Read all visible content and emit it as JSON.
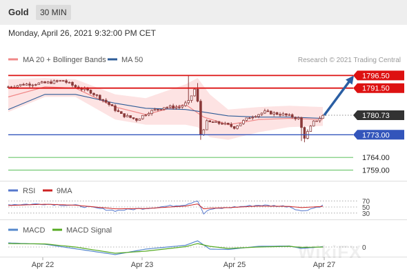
{
  "header": {
    "symbol": "Gold",
    "timeframe": "30 MIN",
    "datetime": "Monday, April 26, 2021 9:32:00 PM CET"
  },
  "colors": {
    "resistance": "#dd1111",
    "support": "#3355bb",
    "target_line": "#22aa22",
    "ma20": "#f08888",
    "bollinger_fill": "#fde3e3",
    "ma50": "#2d5b97",
    "candle": "#8a3a3a",
    "rsi": "#5577cc",
    "ma9": "#cc2222",
    "macd": "#5588cc",
    "macd_signal": "#55aa22",
    "arrow": "#2a5ea3"
  },
  "main_chart": {
    "legend": [
      {
        "label": "MA 20 + Bollinger Bands",
        "color": "#f08888"
      },
      {
        "label": "MA 50",
        "color": "#2d5b97"
      }
    ],
    "credit": "Research © 2021 Trading Central",
    "x_ticks": [
      "Apr 22",
      "Apr 23",
      "Apr 25",
      "Apr 27"
    ],
    "levels": [
      {
        "value": 1796.5,
        "label": "1796.50",
        "kind": "resistance"
      },
      {
        "value": 1791.5,
        "label": "1791.50",
        "kind": "resistance"
      },
      {
        "value": 1780.73,
        "label": "1780.73",
        "kind": "last"
      },
      {
        "value": 1773.0,
        "label": "1773.00",
        "kind": "support"
      },
      {
        "value": 1764.0,
        "label": "1764.00",
        "kind": "target"
      },
      {
        "value": 1759.0,
        "label": "1759.00",
        "kind": "target"
      }
    ]
  },
  "rsi_panel": {
    "legend": [
      {
        "label": "RSI",
        "color": "#5577cc"
      },
      {
        "label": "9MA",
        "color": "#cc2222"
      }
    ],
    "levels": [
      "70",
      "50",
      "30"
    ]
  },
  "macd_panel": {
    "legend": [
      {
        "label": "MACD",
        "color": "#5588cc"
      },
      {
        "label": "MACD Signal",
        "color": "#55aa22"
      }
    ],
    "zero_label": "0"
  },
  "watermark": "WikiFX",
  "chart_data": {
    "type": "candlestick",
    "title": "Gold",
    "ylim": [
      1755,
      1801
    ],
    "x_ticks": [
      "Apr 22",
      "Apr 23",
      "Apr 25",
      "Apr 27"
    ],
    "segments": [
      {
        "x": [
          0,
          5,
          12,
          18,
          22,
          27
        ],
        "y": [
          1792,
          1793,
          1793.5,
          1794.5,
          1792,
          1790
        ]
      },
      {
        "x": [
          27,
          32,
          37,
          42,
          46
        ],
        "y": [
          1790,
          1786,
          1781,
          1779,
          1782
        ]
      },
      {
        "x": [
          46,
          51,
          56,
          59,
          62
        ],
        "y": [
          1782,
          1784,
          1784,
          1786,
          1793.5
        ]
      },
      {
        "x": [
          62,
          63,
          65,
          70,
          74
        ],
        "y": [
          1786,
          1773,
          1778,
          1777.5,
          1776
        ]
      },
      {
        "x": [
          74,
          79,
          84,
          90,
          95
        ],
        "y": [
          1776,
          1780,
          1782,
          1781,
          1779.5
        ]
      },
      {
        "x": [
          95,
          97,
          100,
          103
        ],
        "y": [
          1779.5,
          1772,
          1778,
          1780.5
        ]
      }
    ],
    "series": [
      {
        "name": "MA 20 + Bollinger Bands",
        "x": [
          0,
          12,
          22,
          35,
          45,
          58,
          64,
          72,
          82,
          92,
          103
        ],
        "values": [
          1788,
          1792,
          1791.5,
          1784,
          1781,
          1785,
          1780,
          1777,
          1779,
          1779.5,
          1779
        ]
      },
      {
        "name": "MA 50",
        "x": [
          0,
          12,
          22,
          35,
          45,
          58,
          64,
          72,
          82,
          92,
          103
        ],
        "values": [
          1783,
          1789,
          1789,
          1785.5,
          1783.5,
          1783,
          1782,
          1780.5,
          1780,
          1780,
          1779.5
        ]
      }
    ],
    "bollinger": {
      "x": [
        0,
        12,
        22,
        35,
        45,
        58,
        62,
        66,
        72,
        82,
        92,
        103
      ],
      "upper": [
        1795,
        1795.5,
        1795,
        1789,
        1787.5,
        1793,
        1795.5,
        1789,
        1783,
        1784,
        1784.5,
        1784
      ],
      "lower": [
        1782,
        1788,
        1788,
        1779,
        1777,
        1777,
        1776,
        1772,
        1771,
        1774,
        1776,
        1776.5
      ]
    },
    "forecast": {
      "from": 1780.73,
      "to": 1796.5
    },
    "rsi": {
      "series": [
        {
          "name": "RSI",
          "x": [
            0,
            12,
            22,
            35,
            45,
            58,
            62,
            64,
            66,
            72,
            82,
            92,
            96,
            103
          ],
          "values": [
            58,
            60,
            55,
            38,
            46,
            58,
            72,
            28,
            42,
            48,
            56,
            52,
            36,
            55
          ]
        },
        {
          "name": "9MA",
          "x": [
            0,
            12,
            22,
            35,
            45,
            58,
            62,
            64,
            66,
            72,
            82,
            92,
            96,
            103
          ],
          "values": [
            55,
            59,
            56,
            44,
            45,
            53,
            60,
            44,
            46,
            48,
            53,
            52,
            48,
            52
          ]
        }
      ]
    },
    "macd": {
      "series": [
        {
          "name": "MACD",
          "x": [
            0,
            12,
            22,
            35,
            45,
            58,
            62,
            66,
            72,
            82,
            92,
            96,
            103
          ],
          "values": [
            1.2,
            0.8,
            -0.5,
            -2.2,
            -0.6,
            0.5,
            1.8,
            -0.6,
            -0.7,
            0.2,
            0.3,
            -0.4,
            0.1
          ]
        },
        {
          "name": "MACD Signal",
          "x": [
            0,
            12,
            22,
            35,
            45,
            58,
            62,
            66,
            72,
            82,
            92,
            96,
            103
          ],
          "values": [
            1.0,
            0.9,
            0.0,
            -1.8,
            -1.2,
            0.1,
            1.0,
            0.2,
            -0.4,
            0.0,
            0.2,
            -0.1,
            0.0
          ]
        }
      ]
    }
  }
}
